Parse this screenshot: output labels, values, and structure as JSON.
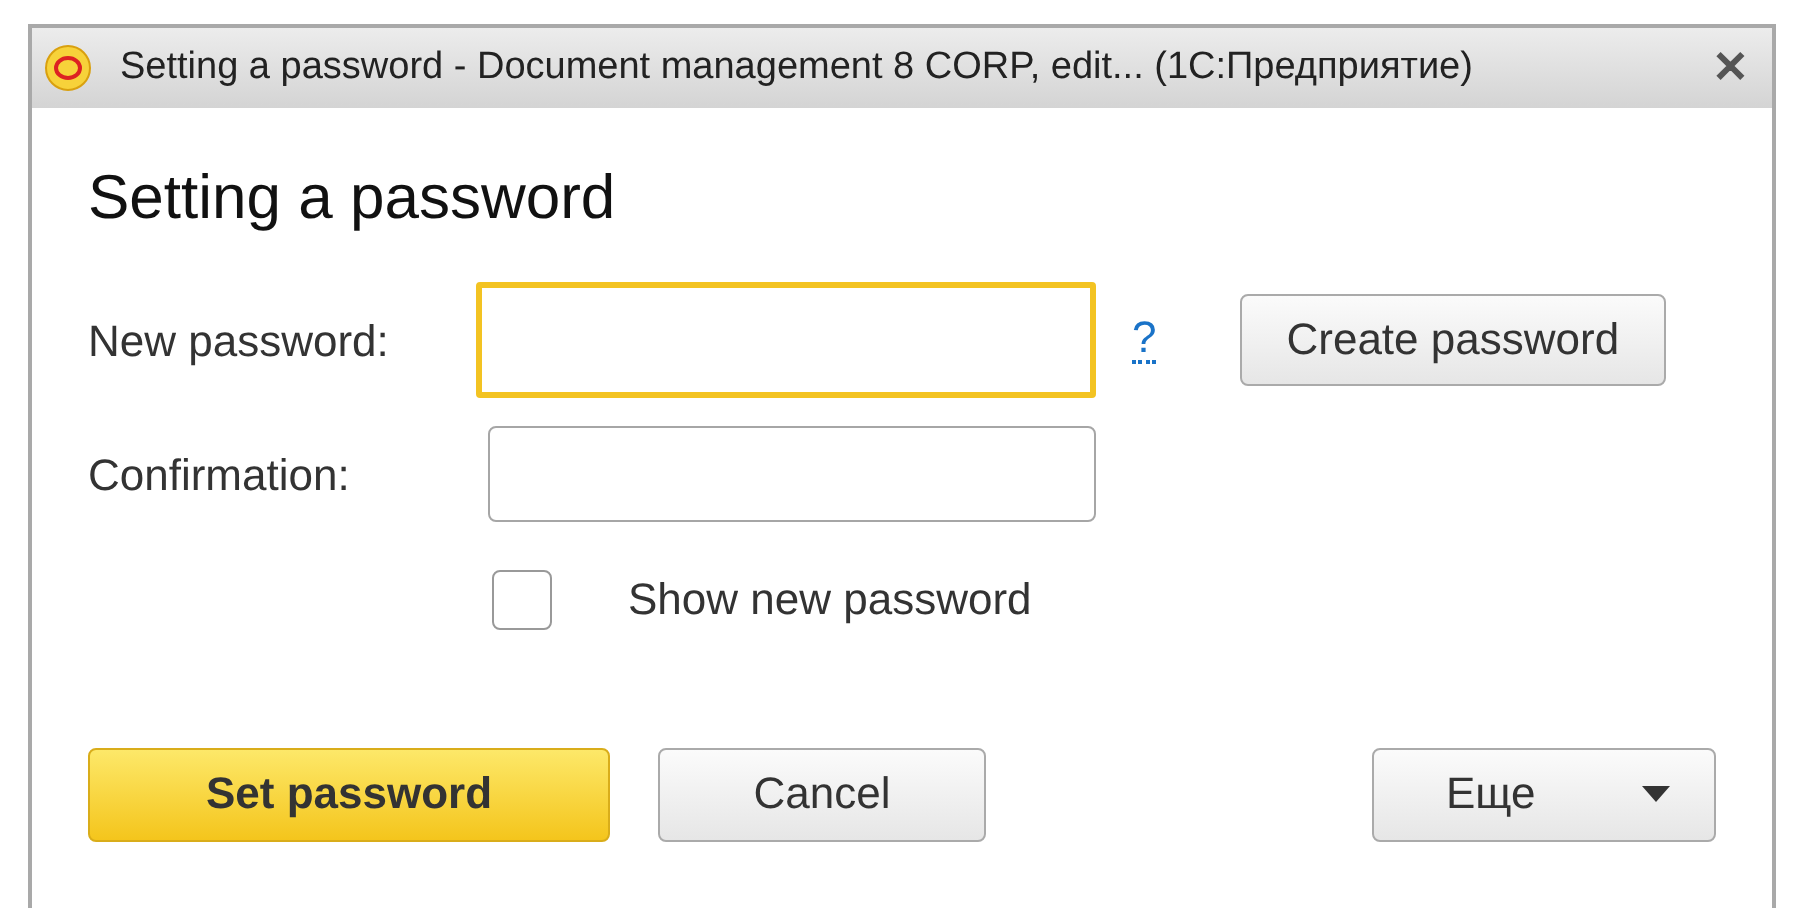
{
  "window": {
    "title": "Setting a password - Document management 8 CORP, edit...  (1C:Предприятие)",
    "close": "✕"
  },
  "heading": "Setting a password",
  "fields": [
    {
      "label": "New password:",
      "focused": true,
      "help": "?",
      "button": "Create password"
    },
    {
      "label": "Confirmation:",
      "focused": false
    }
  ],
  "show_password": {
    "label": "Show new password",
    "checked": false
  },
  "buttons": [
    {
      "label": "Set password",
      "kind": "primary"
    },
    {
      "label": "Cancel",
      "kind": "normal"
    },
    {
      "label": "Еще",
      "kind": "menu"
    }
  ]
}
